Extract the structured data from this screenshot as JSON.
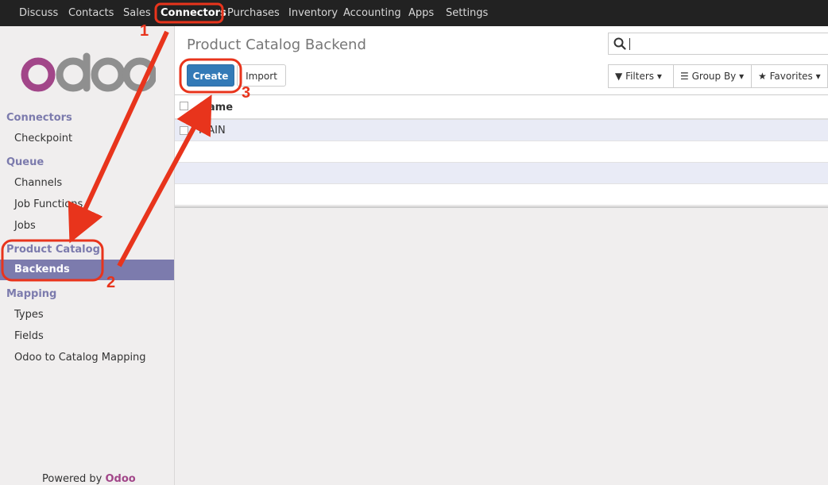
{
  "topbar": {
    "items": [
      {
        "label": "Discuss"
      },
      {
        "label": "Contacts"
      },
      {
        "label": "Sales"
      },
      {
        "label": "Connectors"
      },
      {
        "label": "Purchases"
      },
      {
        "label": "Inventory"
      },
      {
        "label": "Accounting"
      },
      {
        "label": "Apps"
      },
      {
        "label": "Settings"
      }
    ],
    "active": "Connectors"
  },
  "sidebar": {
    "logo_text": "odoo",
    "sections": [
      {
        "heading": "Connectors",
        "items": [
          "Checkpoint"
        ]
      },
      {
        "heading": "Queue",
        "items": [
          "Channels",
          "Job Functions",
          "Jobs"
        ]
      },
      {
        "heading": "Product Catalog",
        "items": [
          "Backends"
        ]
      },
      {
        "heading": "Mapping",
        "items": [
          "Types",
          "Fields",
          "Odoo to Catalog Mapping"
        ]
      }
    ],
    "active_item": "Backends",
    "powered_by": "Powered by",
    "powered_brand": "Odoo"
  },
  "main": {
    "title": "Product Catalog Backend",
    "create_label": "Create",
    "import_label": "Import",
    "search_value": "",
    "filters_label": "Filters",
    "groupby_label": "Group By",
    "favorites_label": "Favorites",
    "column_name": "Name",
    "rows": [
      "MAIN",
      "",
      "",
      ""
    ]
  },
  "annotations": {
    "step1": "1",
    "step2": "2",
    "step3": "3"
  },
  "colors": {
    "topbar": "#222222",
    "sidebar_heading": "#7c7bad",
    "active_item_bg": "#7c7bad",
    "primary_button": "#337ab7",
    "logo_purple": "#a24689",
    "logo_grey": "#8f8f8f",
    "annotation_red": "#e8341c"
  }
}
